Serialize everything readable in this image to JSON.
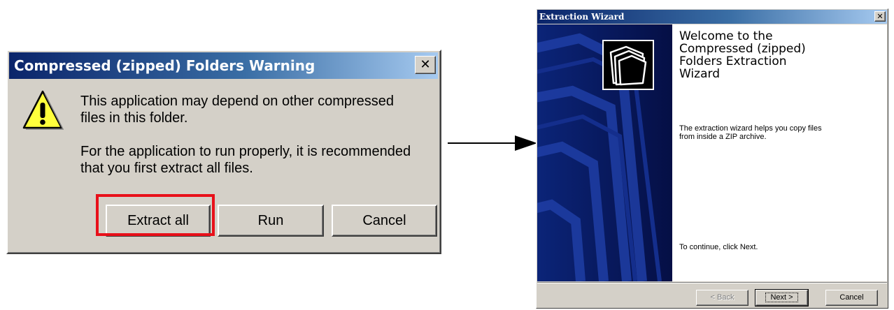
{
  "warning_dialog": {
    "title": "Compressed (zipped) Folders Warning",
    "close_label": "✕",
    "icon": "warning-icon",
    "message_line1a": "This application may depend on other compressed",
    "message_line1b": "files in this folder.",
    "message_line2a": "For the application to run properly, it is recommended",
    "message_line2b": "that you first extract all files.",
    "buttons": {
      "extract_all": "Extract all",
      "run": "Run",
      "cancel": "Cancel"
    },
    "highlight_color": "#e8101a"
  },
  "wizard": {
    "title": "Extraction Wizard",
    "close_label": "✕",
    "side_icon": "zip-folder-icon",
    "heading_lines": [
      "Welcome to the",
      "Compressed (zipped)",
      "Folders Extraction",
      "Wizard"
    ],
    "description_lines": [
      "The extraction wizard helps you copy files",
      "from inside a ZIP archive."
    ],
    "continue_text": "To continue, click Next.",
    "buttons": {
      "back": "< Back",
      "next": "Next >",
      "cancel": "Cancel"
    }
  },
  "colors": {
    "title_bar": "#0a246a",
    "dialog_face": "#d4d0c8",
    "wizard_side": "#071a5a"
  }
}
